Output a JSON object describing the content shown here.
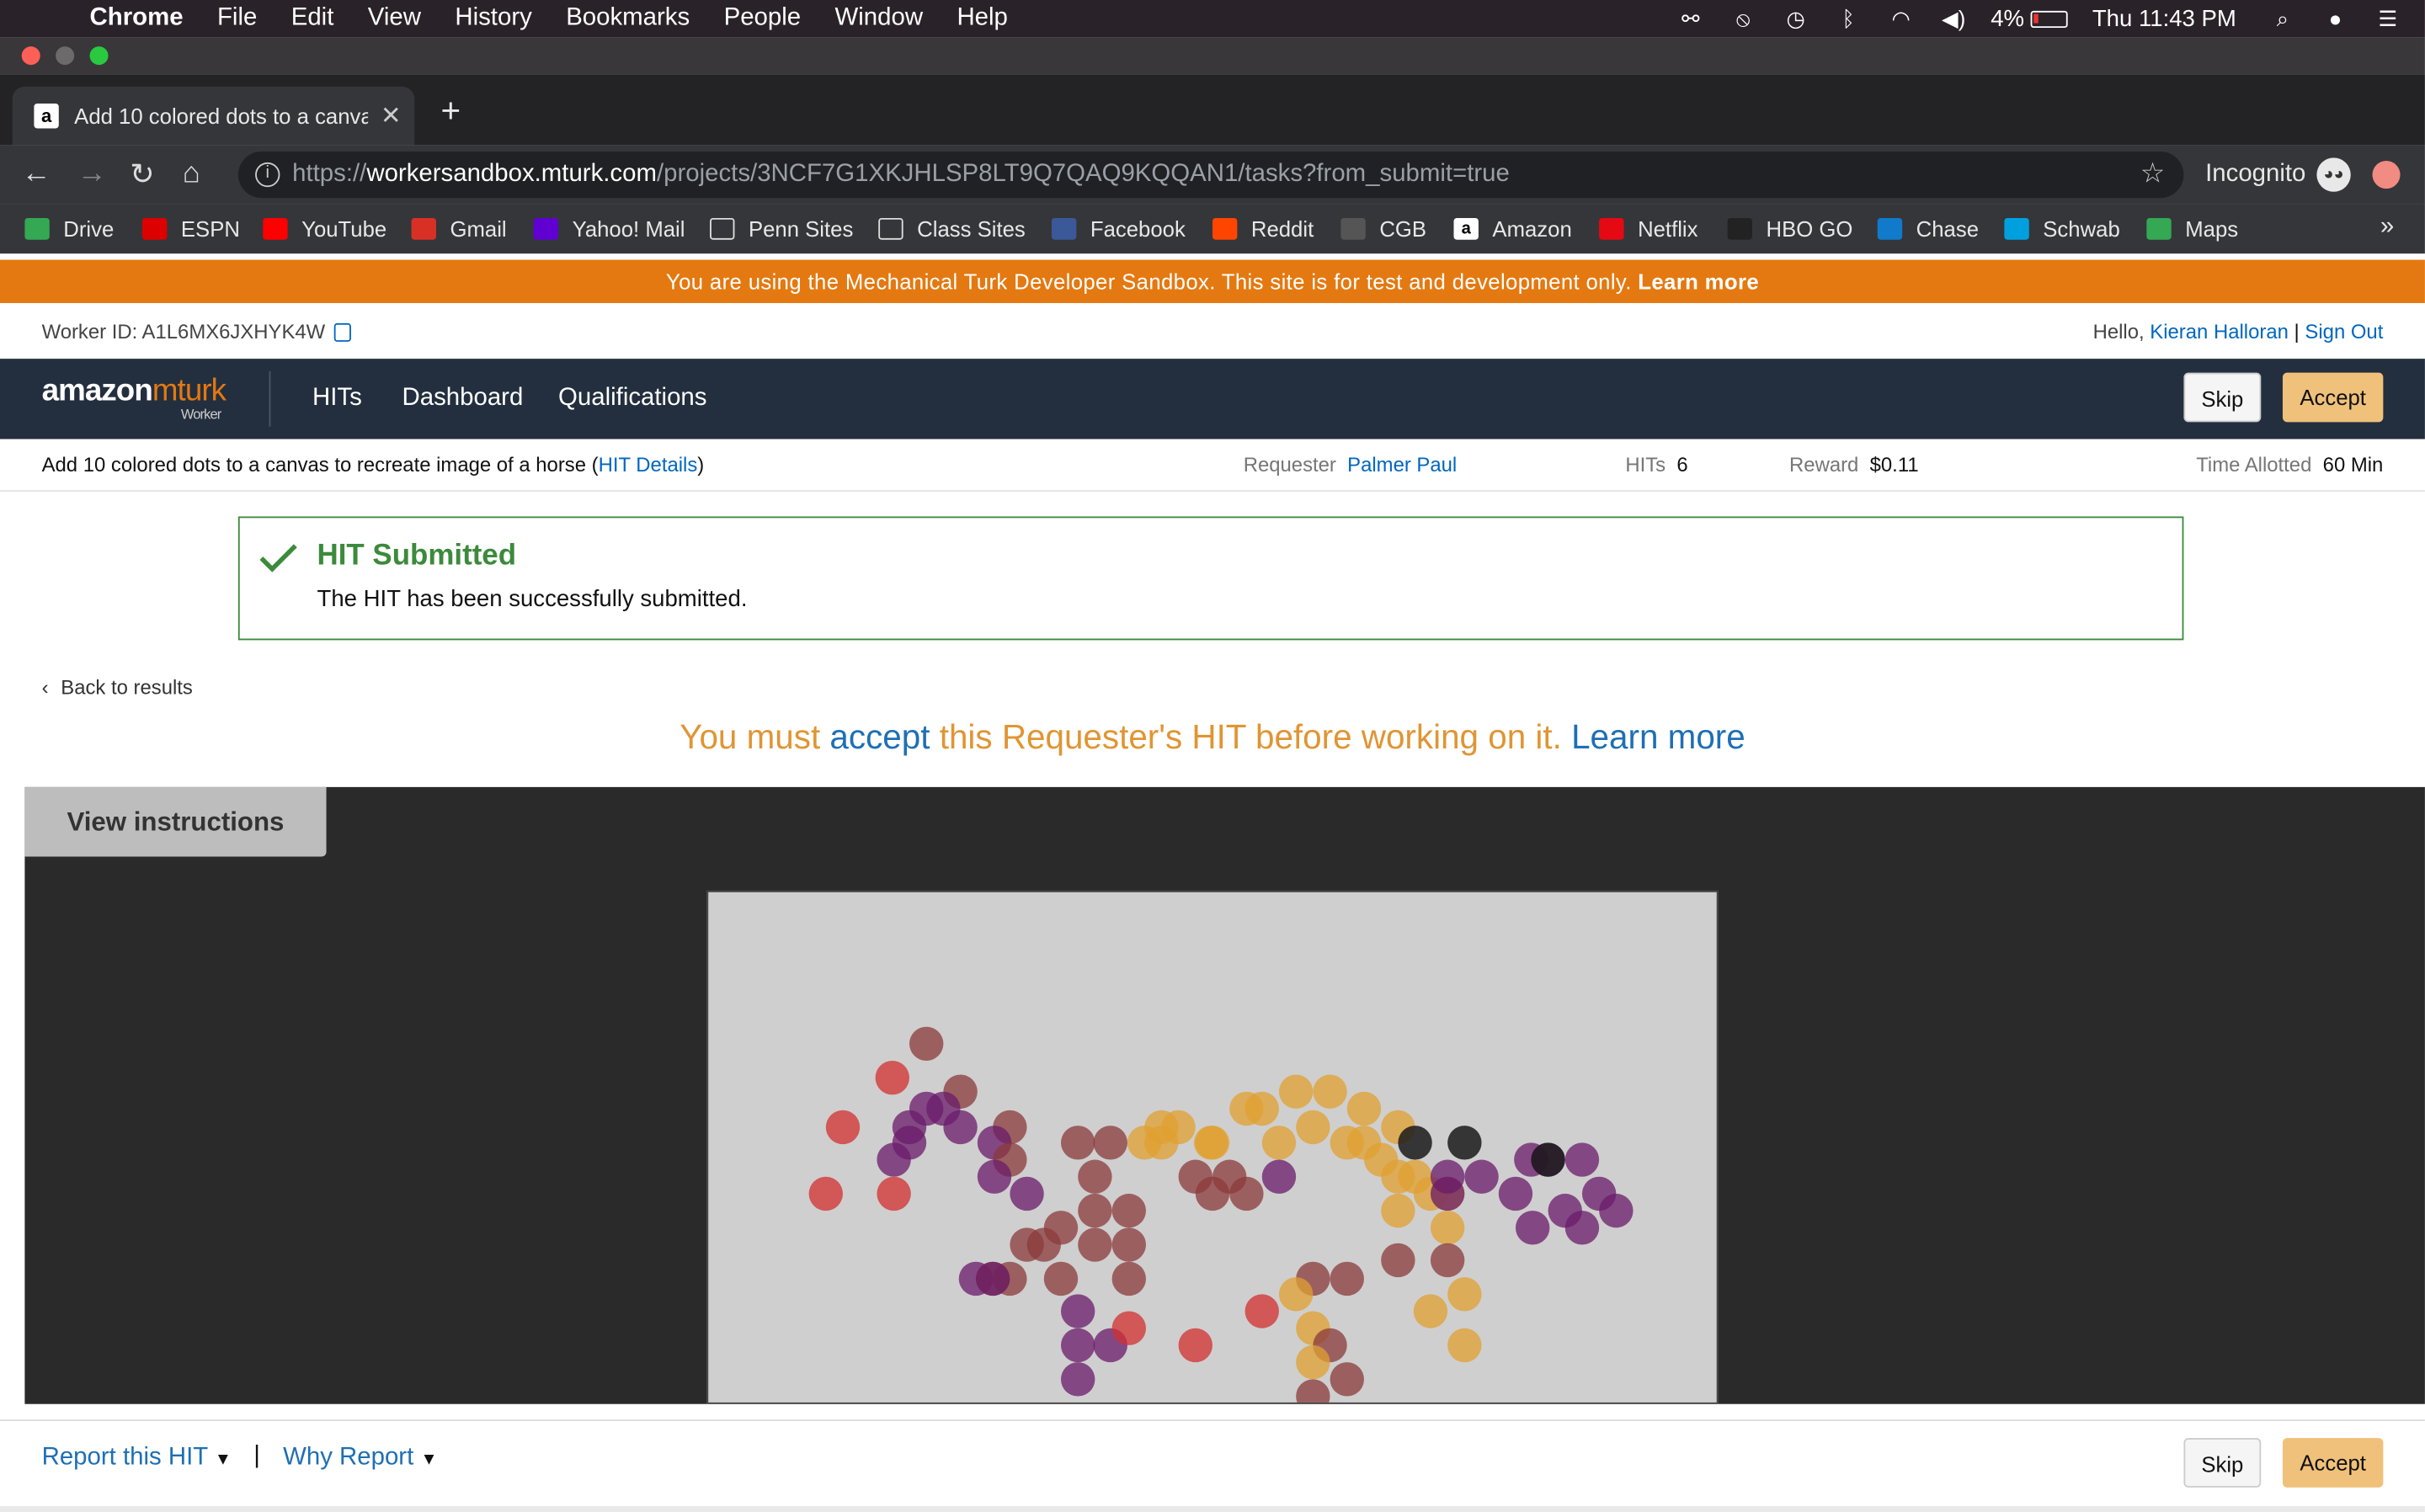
{
  "menubar": {
    "app": "Chrome",
    "items": [
      "File",
      "Edit",
      "View",
      "History",
      "Bookmarks",
      "People",
      "Window",
      "Help"
    ],
    "battery": "4%",
    "clock": "Thu 11:43 PM"
  },
  "tab": {
    "title": "Add 10 colored dots to a canvas to recreate image of a horse",
    "favicon": "a"
  },
  "address": {
    "scheme": "https://",
    "host": "workersandbox.mturk.com",
    "path": "/projects/3NCF7G1XKJHLSP8LT9Q7QAQ9KQQAN1/tasks?from_submit=true"
  },
  "incognito": "Incognito",
  "bookmarks": [
    {
      "label": "Drive",
      "icon": "drive-icon",
      "color": "#34a853"
    },
    {
      "label": "ESPN",
      "icon": "espn-icon",
      "color": "#d00"
    },
    {
      "label": "YouTube",
      "icon": "youtube-icon",
      "color": "#f00"
    },
    {
      "label": "Gmail",
      "icon": "gmail-icon",
      "color": "#d93025"
    },
    {
      "label": "Yahoo! Mail",
      "icon": "yahoo-icon",
      "color": "#6001d2"
    },
    {
      "label": "Penn Sites",
      "icon": "folder-icon",
      "color": "#35363a"
    },
    {
      "label": "Class Sites",
      "icon": "folder-icon",
      "color": "#35363a"
    },
    {
      "label": "Facebook",
      "icon": "facebook-icon",
      "color": "#3b5998"
    },
    {
      "label": "Reddit",
      "icon": "reddit-icon",
      "color": "#ff4500"
    },
    {
      "label": "CGB",
      "icon": "cgb-icon",
      "color": "#555"
    },
    {
      "label": "Amazon",
      "icon": "amazon-icon",
      "color": "#fff"
    },
    {
      "label": "Netflix",
      "icon": "netflix-icon",
      "color": "#e50914"
    },
    {
      "label": "HBO GO",
      "icon": "hbo-icon",
      "color": "#222"
    },
    {
      "label": "Chase",
      "icon": "chase-icon",
      "color": "#117aca"
    },
    {
      "label": "Schwab",
      "icon": "schwab-icon",
      "color": "#00a0df"
    },
    {
      "label": "Maps",
      "icon": "maps-icon",
      "color": "#34a853"
    }
  ],
  "sandbox": {
    "text": "You are using the Mechanical Turk Developer Sandbox. This site is for test and development only.",
    "link": "Learn more"
  },
  "worker": {
    "id": "Worker ID: A1L6MX6JXHYK4W",
    "hello": "Hello,",
    "name": "Kieran Halloran",
    "signout": "Sign Out"
  },
  "nav": {
    "logo_a": "amazon",
    "logo_b": "mturk",
    "logo_sub": "Worker",
    "items": [
      "HITs",
      "Dashboard",
      "Qualifications"
    ],
    "skip": "Skip",
    "accept": "Accept"
  },
  "hit": {
    "title": "Add 10 colored dots to a canvas to recreate image of a horse",
    "details_open": "(",
    "details": "HIT Details",
    "details_close": ")",
    "requester_label": "Requester",
    "requester": "Palmer Paul",
    "hits_label": "HITs",
    "hits": "6",
    "reward_label": "Reward",
    "reward": "$0.11",
    "time_label": "Time Allotted",
    "time": "60 Min"
  },
  "success": {
    "title": "HIT Submitted",
    "message": "The HIT has been successfully submitted."
  },
  "back": "Back to results",
  "must": {
    "pre": "You must ",
    "accept": "accept",
    "post": " this Requester's HIT before working on it. ",
    "learn": "Learn more"
  },
  "view_instructions": "View instructions",
  "canvas_colors": {
    "red": "#d32f2f",
    "maroon": "#8b3a3a",
    "purple": "#6a1b6a",
    "orange": "#e0a030",
    "black": "#1a1a1a"
  },
  "dots": [
    [
      "maroon",
      141,
      98
    ],
    [
      "red",
      119,
      120
    ],
    [
      "maroon",
      163,
      129
    ],
    [
      "red",
      87,
      152
    ],
    [
      "purple",
      141,
      140
    ],
    [
      "purple",
      130,
      152
    ],
    [
      "purple",
      152,
      140
    ],
    [
      "purple",
      163,
      152
    ],
    [
      "purple",
      130,
      162
    ],
    [
      "purple",
      120,
      173
    ],
    [
      "maroon",
      195,
      152
    ],
    [
      "purple",
      185,
      162
    ],
    [
      "maroon",
      195,
      173
    ],
    [
      "purple",
      185,
      184
    ],
    [
      "red",
      76,
      195
    ],
    [
      "red",
      120,
      195
    ],
    [
      "purple",
      206,
      195
    ],
    [
      "maroon",
      239,
      162
    ],
    [
      "maroon",
      260,
      162
    ],
    [
      "orange",
      282,
      162
    ],
    [
      "orange",
      293,
      152
    ],
    [
      "orange",
      304,
      152
    ],
    [
      "orange",
      325,
      162
    ],
    [
      "orange",
      293,
      162
    ],
    [
      "maroon",
      250,
      184
    ],
    [
      "maroon",
      250,
      206
    ],
    [
      "maroon",
      272,
      206
    ],
    [
      "maroon",
      228,
      217
    ],
    [
      "maroon",
      250,
      228
    ],
    [
      "maroon",
      272,
      228
    ],
    [
      "maroon",
      217,
      228
    ],
    [
      "maroon",
      272,
      250
    ],
    [
      "purple",
      173,
      250
    ],
    [
      "maroon",
      184,
      250
    ],
    [
      "maroon",
      195,
      250
    ],
    [
      "purple",
      184,
      250
    ],
    [
      "maroon",
      228,
      250
    ],
    [
      "maroon",
      206,
      228
    ],
    [
      "purple",
      239,
      271
    ],
    [
      "purple",
      260,
      293
    ],
    [
      "purple",
      239,
      293
    ],
    [
      "purple",
      239,
      315
    ],
    [
      "red",
      272,
      282
    ],
    [
      "maroon",
      315,
      184
    ],
    [
      "maroon",
      326,
      195
    ],
    [
      "maroon",
      337,
      184
    ],
    [
      "maroon",
      348,
      195
    ],
    [
      "purple",
      369,
      184
    ],
    [
      "orange",
      326,
      162
    ],
    [
      "orange",
      348,
      140
    ],
    [
      "orange",
      358,
      140
    ],
    [
      "orange",
      380,
      129
    ],
    [
      "orange",
      402,
      129
    ],
    [
      "orange",
      369,
      162
    ],
    [
      "orange",
      391,
      152
    ],
    [
      "orange",
      424,
      140
    ],
    [
      "orange",
      446,
      152
    ],
    [
      "orange",
      413,
      162
    ],
    [
      "orange",
      424,
      162
    ],
    [
      "orange",
      435,
      173
    ],
    [
      "orange",
      446,
      184
    ],
    [
      "orange",
      457,
      184
    ],
    [
      "orange",
      446,
      206
    ],
    [
      "orange",
      478,
      217
    ],
    [
      "orange",
      467,
      195
    ],
    [
      "orange",
      478,
      195
    ],
    [
      "black",
      457,
      162
    ],
    [
      "black",
      489,
      162
    ],
    [
      "purple",
      478,
      184
    ],
    [
      "purple",
      478,
      195
    ],
    [
      "purple",
      500,
      184
    ],
    [
      "purple",
      522,
      195
    ],
    [
      "purple",
      532,
      173
    ],
    [
      "purple",
      543,
      173
    ],
    [
      "black",
      543,
      173
    ],
    [
      "purple",
      565,
      173
    ],
    [
      "purple",
      554,
      206
    ],
    [
      "purple",
      565,
      217
    ],
    [
      "purple",
      533,
      217
    ],
    [
      "purple",
      576,
      195
    ],
    [
      "purple",
      587,
      206
    ],
    [
      "maroon",
      446,
      238
    ],
    [
      "maroon",
      478,
      238
    ],
    [
      "orange",
      489,
      260
    ],
    [
      "orange",
      467,
      271
    ],
    [
      "orange",
      489,
      293
    ],
    [
      "maroon",
      391,
      250
    ],
    [
      "maroon",
      413,
      250
    ],
    [
      "orange",
      380,
      260
    ],
    [
      "orange",
      391,
      282
    ],
    [
      "maroon",
      402,
      293
    ],
    [
      "orange",
      391,
      304
    ],
    [
      "maroon",
      413,
      315
    ],
    [
      "maroon",
      391,
      326
    ],
    [
      "red",
      358,
      271
    ],
    [
      "red",
      315,
      293
    ]
  ],
  "footer": {
    "report": "Report this HIT",
    "sep": "|",
    "why": "Why Report",
    "skip": "Skip",
    "accept": "Accept"
  }
}
